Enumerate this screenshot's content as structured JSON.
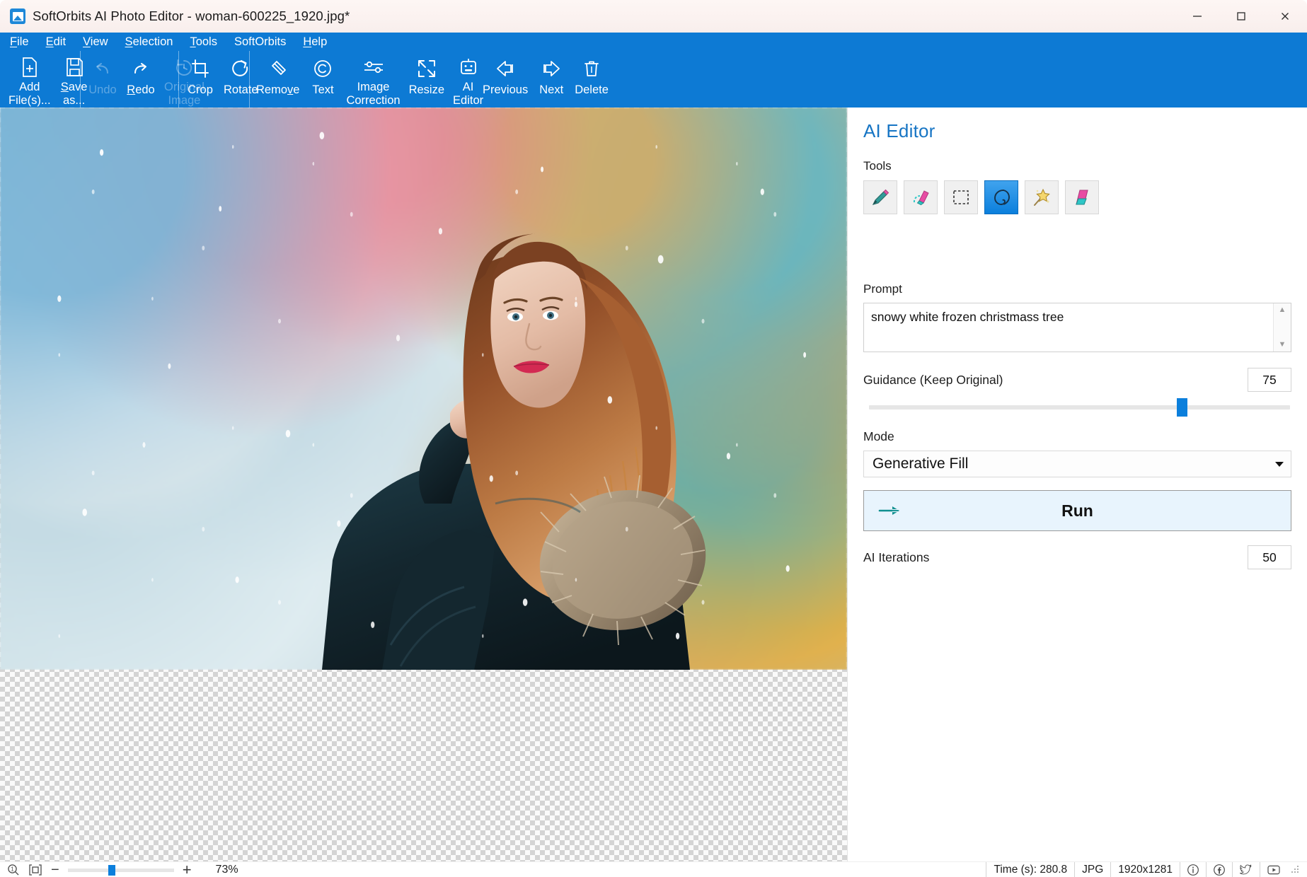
{
  "window": {
    "title": "SoftOrbits AI Photo Editor - woman-600225_1920.jpg*",
    "minimize_label": "Minimize",
    "maximize_label": "Maximize",
    "close_label": "Close",
    "app_icon": "app-logo-icon"
  },
  "menubar": {
    "items": [
      {
        "label": "File",
        "accel": "F"
      },
      {
        "label": "Edit",
        "accel": "E"
      },
      {
        "label": "View",
        "accel": "V"
      },
      {
        "label": "Selection",
        "accel": "S"
      },
      {
        "label": "Tools",
        "accel": "T"
      },
      {
        "label": "SoftOrbits",
        "accel": ""
      },
      {
        "label": "Help",
        "accel": "H"
      }
    ]
  },
  "toolbar": {
    "groups": [
      {
        "buttons": [
          {
            "label": "Add\nFile(s)...",
            "icon": "add-file-icon",
            "enabled": true
          },
          {
            "label": "Save\nas...",
            "icon": "save-icon",
            "enabled": true,
            "accel": "S"
          }
        ]
      },
      {
        "buttons": [
          {
            "label": "Undo",
            "icon": "undo-icon",
            "enabled": false
          },
          {
            "label": "Redo",
            "icon": "redo-icon",
            "enabled": true,
            "accel": "R"
          },
          {
            "label": "Original\nImage",
            "icon": "history-icon",
            "enabled": false
          }
        ]
      },
      {
        "buttons": [
          {
            "label": "Crop",
            "icon": "crop-icon",
            "enabled": true
          },
          {
            "label": "Rotate",
            "icon": "rotate-icon",
            "enabled": true
          }
        ]
      },
      {
        "buttons": [
          {
            "label": "Remove",
            "icon": "eraser-icon",
            "enabled": true,
            "accel": "v"
          },
          {
            "label": "Text",
            "icon": "copyright-icon",
            "enabled": true
          },
          {
            "label": "Image\nCorrection",
            "icon": "sliders-icon",
            "enabled": true
          },
          {
            "label": "Resize",
            "icon": "resize-icon",
            "enabled": true
          },
          {
            "label": "AI\nEditor",
            "icon": "robot-icon",
            "enabled": true
          }
        ]
      },
      {
        "buttons": [
          {
            "label": "Previous",
            "icon": "arrow-left-icon",
            "enabled": true
          },
          {
            "label": "Next",
            "icon": "arrow-right-icon",
            "enabled": true
          },
          {
            "label": "Delete",
            "icon": "trash-icon",
            "enabled": true
          }
        ]
      }
    ]
  },
  "panel": {
    "title": "AI Editor",
    "tools_label": "Tools",
    "tools": [
      {
        "name": "brush-tool",
        "icon": "brush-icon",
        "active": false
      },
      {
        "name": "eraser-tool",
        "icon": "eraser-color-icon",
        "active": false
      },
      {
        "name": "rectangle-select-tool",
        "icon": "rect-select-icon",
        "active": false
      },
      {
        "name": "lasso-select-tool",
        "icon": "lasso-icon",
        "active": true
      },
      {
        "name": "magic-wand-tool",
        "icon": "magic-wand-icon",
        "active": false
      },
      {
        "name": "fill-tool",
        "icon": "fill-icon",
        "active": false
      }
    ],
    "prompt_label": "Prompt",
    "prompt_value": "snowy white frozen christmass tree",
    "prompt_placeholder": "",
    "guidance_label": "Guidance (Keep Original)",
    "guidance_value": "75",
    "guidance_min": 0,
    "guidance_max": 100,
    "mode_label": "Mode",
    "mode_value": "Generative Fill",
    "mode_options": [
      "Generative Fill"
    ],
    "run_label": "Run",
    "run_icon": "arrow-run-icon",
    "iterations_label": "AI Iterations",
    "iterations_value": "50"
  },
  "statusbar": {
    "zoom_icon": "zoom-1-to-1-icon",
    "fit_icon": "fit-to-window-icon",
    "zoom_out_label": "−",
    "zoom_in_label": "+",
    "zoom_percent": "73%",
    "zoom_slider_value": 41,
    "time_label": "Time (s): 280.8",
    "format_label": "JPG",
    "dimensions_label": "1920x1281",
    "info_icon": "info-icon",
    "facebook_icon": "facebook-icon",
    "twitter_icon": "twitter-icon",
    "youtube_icon": "youtube-icon"
  },
  "colors": {
    "accent": "#0d7ad4",
    "panel_title": "#1775c4",
    "slider": "#0b7fdc",
    "run_bg": "#e8f4fd",
    "titlebar": "#fbf2f0"
  }
}
